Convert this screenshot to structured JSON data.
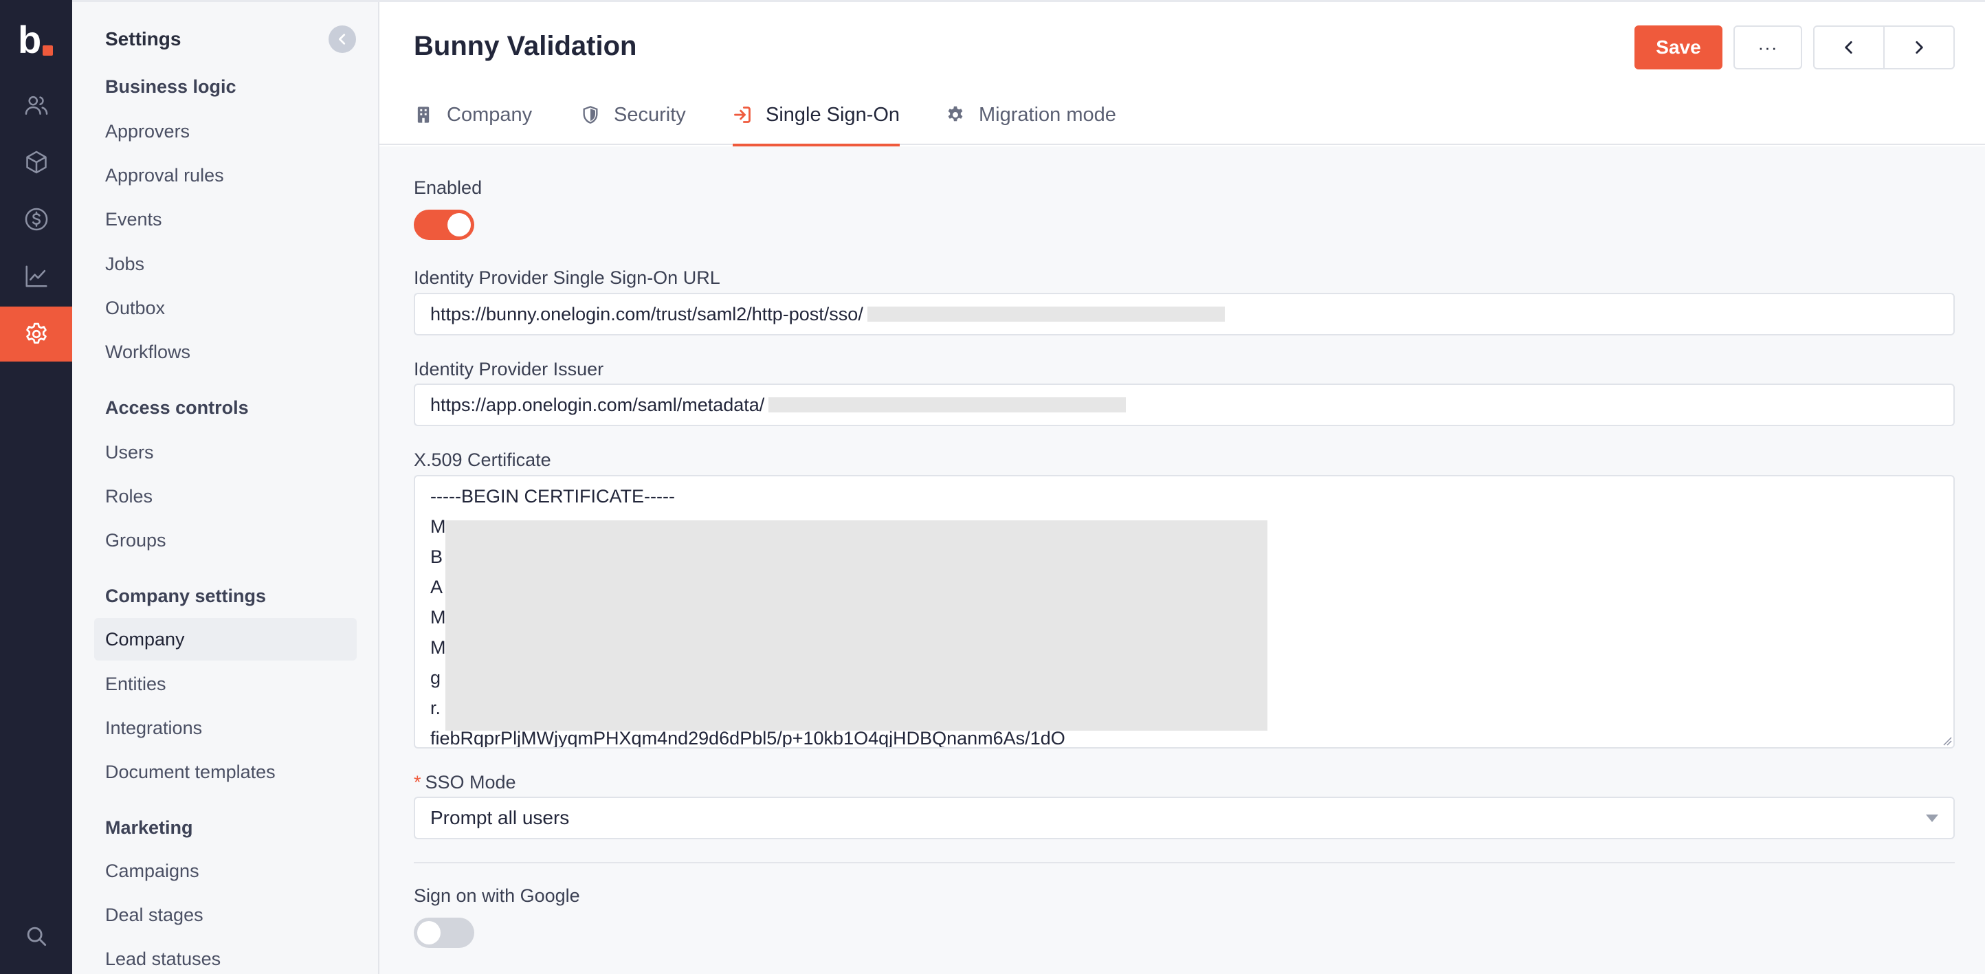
{
  "app": {
    "logo_text": "b"
  },
  "sidebar": {
    "title": "Settings",
    "sections": [
      {
        "label": "Business logic",
        "items": [
          "Approvers",
          "Approval rules",
          "Events",
          "Jobs",
          "Outbox",
          "Workflows"
        ]
      },
      {
        "label": "Access controls",
        "items": [
          "Users",
          "Roles",
          "Groups"
        ]
      },
      {
        "label": "Company settings",
        "items": [
          "Company",
          "Entities",
          "Integrations",
          "Document templates"
        ]
      },
      {
        "label": "Marketing",
        "items": [
          "Campaigns",
          "Deal stages",
          "Lead statuses"
        ]
      }
    ],
    "selected_item": "Company"
  },
  "header": {
    "title": "Bunny Validation",
    "save_label": "Save",
    "more_label": "···"
  },
  "tabs": [
    {
      "label": "Company",
      "icon": "building-icon"
    },
    {
      "label": "Security",
      "icon": "shield-icon"
    },
    {
      "label": "Single Sign-On",
      "icon": "sign-in-icon"
    },
    {
      "label": "Migration mode",
      "icon": "gear-icon"
    }
  ],
  "active_tab": "Single Sign-On",
  "form": {
    "enabled_label": "Enabled",
    "enabled": true,
    "sso_url_label": "Identity Provider Single Sign-On URL",
    "sso_url_value": "https://bunny.onelogin.com/trust/saml2/http-post/sso/",
    "issuer_label": "Identity Provider Issuer",
    "issuer_value": "https://app.onelogin.com/saml/metadata/",
    "cert_label": "X.509 Certificate",
    "cert_lines": [
      "-----BEGIN CERTIFICATE-----",
      "M",
      "B",
      "A",
      "M",
      "M",
      "g",
      "r.",
      "fiebRqprPljMWjyqmPHXqm4nd29d6dPbl5/p+10kb1O4qjHDBQnanm6As/1dO"
    ],
    "sso_mode_label": "SSO Mode",
    "sso_mode_required_mark": "*",
    "sso_mode_value": "Prompt all users",
    "google_label": "Sign on with Google",
    "google_enabled": false
  },
  "colors": {
    "accent": "#ef5a3c",
    "rail": "#1f2234"
  }
}
